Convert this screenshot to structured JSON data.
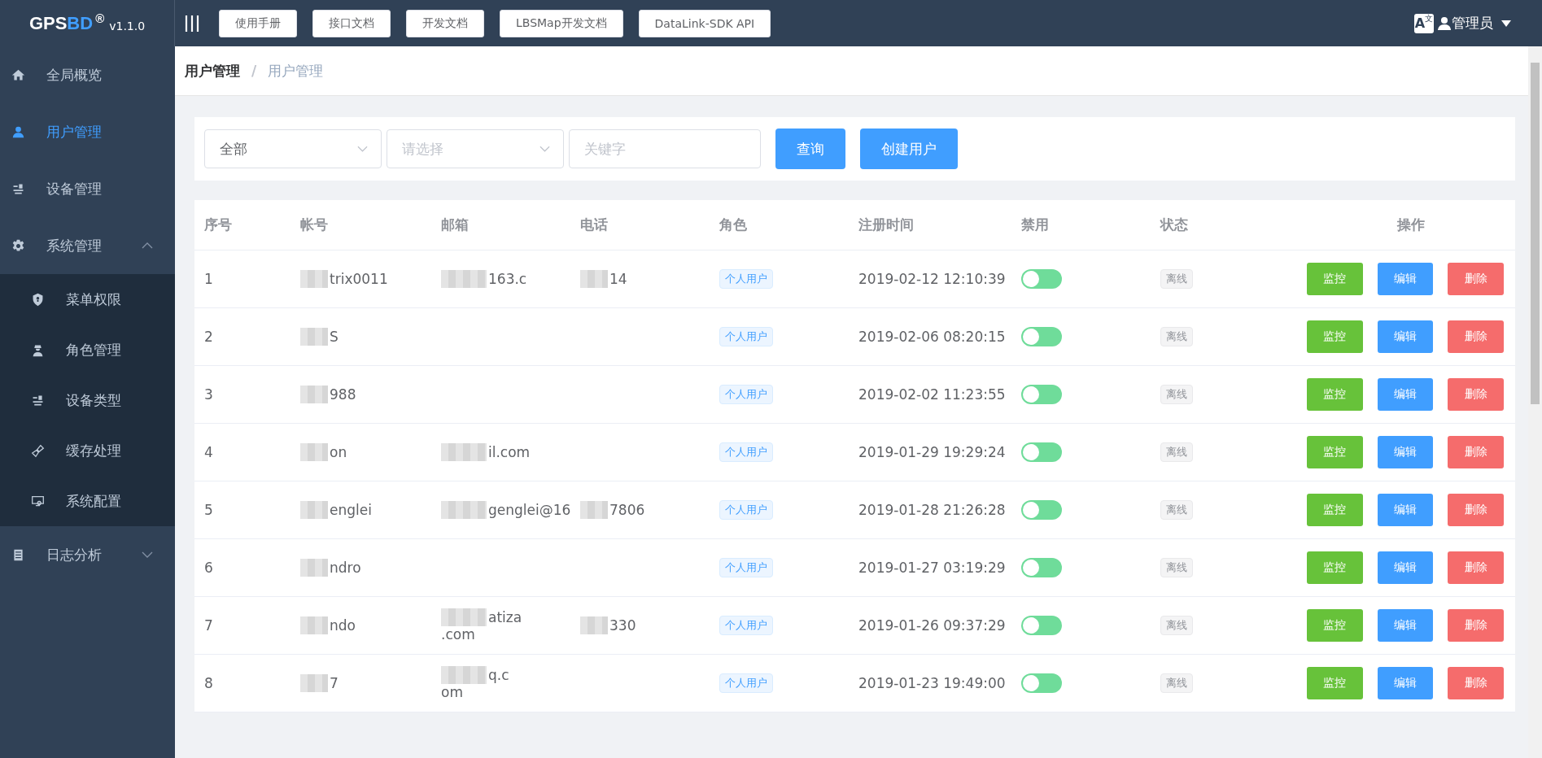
{
  "logo": {
    "brand_1": "GPS",
    "brand_2": "BD",
    "mark": "®",
    "version": "v1.1.0"
  },
  "top_links": [
    "使用手册",
    "接口文档",
    "开发文档",
    "LBSMap开发文档",
    "DataLink-SDK API"
  ],
  "user": {
    "lang": [
      "A",
      "文"
    ],
    "name": "管理员"
  },
  "sidebar": {
    "items": [
      {
        "label": "全局概览",
        "selected": false
      },
      {
        "label": "用户管理",
        "selected": true
      },
      {
        "label": "设备管理",
        "selected": false
      },
      {
        "label": "系统管理",
        "selected": false,
        "expanded": true,
        "children": [
          {
            "label": "菜单权限",
            "selected": false
          },
          {
            "label": "角色管理",
            "selected": false
          },
          {
            "label": "设备类型",
            "selected": false
          },
          {
            "label": "缓存处理",
            "selected": false
          },
          {
            "label": "系统配置",
            "selected": false
          }
        ]
      },
      {
        "label": "日志分析",
        "selected": false,
        "expanded": false
      }
    ]
  },
  "breadcrumb": [
    "用户管理",
    "用户管理"
  ],
  "breadcrumb_separator": "/",
  "filters": {
    "scope": {
      "value": "全部"
    },
    "type": {
      "placeholder": "请选择"
    },
    "keyword": {
      "placeholder": "关键字"
    },
    "buttons": [
      "查询",
      "创建用户"
    ]
  },
  "table": {
    "columns": [
      "序号",
      "帐号",
      "邮箱",
      "电话",
      "角色",
      "注册时间",
      "禁用",
      "状态",
      "操作"
    ],
    "rows": [
      {
        "index": "1",
        "account": "trix0011",
        "email": [
          "163.c"
        ],
        "phone": "14",
        "role": "个人用户",
        "registered": "2019-02-12 12:10:39",
        "disabled": false,
        "status": "离线",
        "actions": [
          "监控",
          "编辑",
          "删除"
        ]
      },
      {
        "index": "2",
        "account": "S",
        "email": [],
        "phone": "",
        "role": "个人用户",
        "registered": "2019-02-06 08:20:15",
        "disabled": false,
        "status": "离线",
        "actions": [
          "监控",
          "编辑",
          "删除"
        ]
      },
      {
        "index": "3",
        "account": "988",
        "email": [],
        "phone": "",
        "role": "个人用户",
        "registered": "2019-02-02 11:23:55",
        "disabled": false,
        "status": "离线",
        "actions": [
          "监控",
          "编辑",
          "删除"
        ]
      },
      {
        "index": "4",
        "account": "on",
        "email": [
          "il.com"
        ],
        "phone": "",
        "role": "个人用户",
        "registered": "2019-01-29 19:29:24",
        "disabled": false,
        "status": "离线",
        "actions": [
          "监控",
          "编辑",
          "删除"
        ]
      },
      {
        "index": "5",
        "account": "englei",
        "email": [
          "genglei@16"
        ],
        "phone": "7806",
        "role": "个人用户",
        "registered": "2019-01-28 21:26:28",
        "disabled": false,
        "status": "离线",
        "actions": [
          "监控",
          "编辑",
          "删除"
        ]
      },
      {
        "index": "6",
        "account": "ndro",
        "email": [],
        "phone": "",
        "role": "个人用户",
        "registered": "2019-01-27 03:19:29",
        "disabled": false,
        "status": "离线",
        "actions": [
          "监控",
          "编辑",
          "删除"
        ]
      },
      {
        "index": "7",
        "account": "ndo",
        "email": [
          "atiza",
          ".com"
        ],
        "phone": "330",
        "role": "个人用户",
        "registered": "2019-01-26 09:37:29",
        "disabled": false,
        "status": "离线",
        "actions": [
          "监控",
          "编辑",
          "删除"
        ]
      },
      {
        "index": "8",
        "account": "7",
        "email": [
          "q.c",
          "om"
        ],
        "phone": "",
        "role": "个人用户",
        "registered": "2019-01-23 19:49:00",
        "disabled": false,
        "status": "离线",
        "actions": [
          "监控",
          "编辑",
          "删除"
        ]
      }
    ]
  }
}
